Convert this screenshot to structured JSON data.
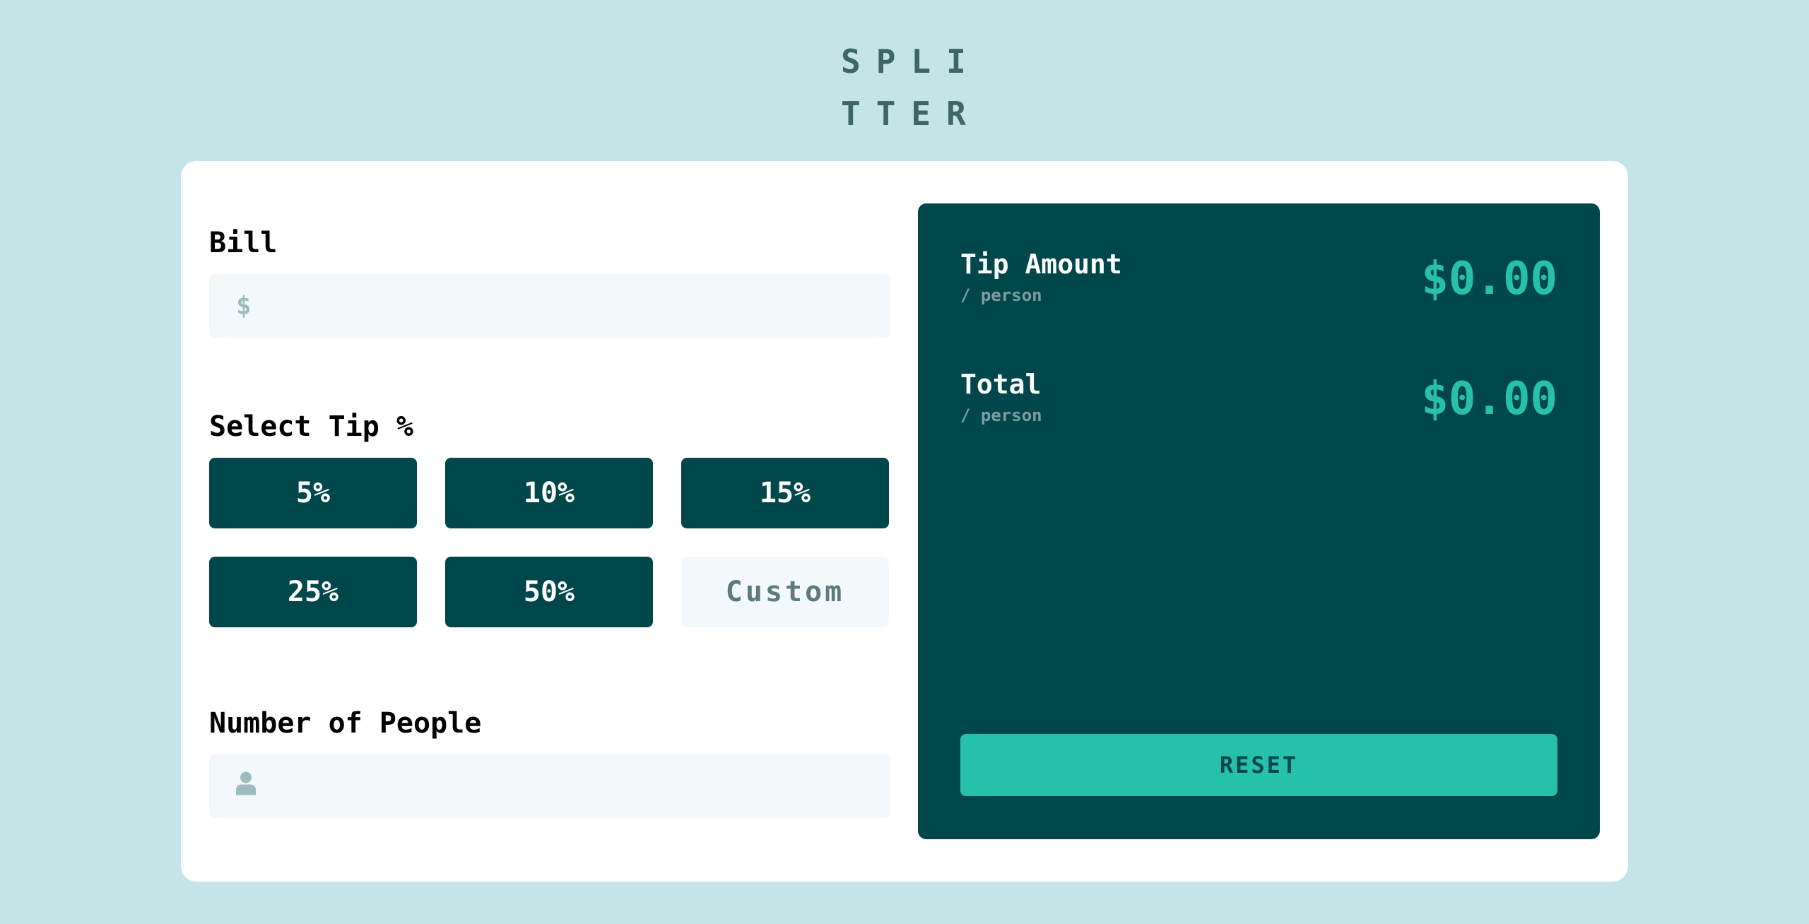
{
  "app": {
    "logo_line1": "SPLI",
    "logo_line2": "TTER"
  },
  "bill": {
    "label": "Bill",
    "icon": "dollar-icon",
    "icon_glyph": "$",
    "value": ""
  },
  "tip": {
    "label": "Select Tip %",
    "options": [
      "5%",
      "10%",
      "15%",
      "25%",
      "50%"
    ],
    "custom_placeholder": "Custom"
  },
  "people": {
    "label": "Number of People",
    "icon": "person-icon",
    "value": ""
  },
  "results": {
    "tip_amount_label": "Tip Amount",
    "tip_amount_sub": "/ person",
    "tip_amount_value": "$0.00",
    "total_label": "Total",
    "total_sub": "/ person",
    "total_value": "$0.00",
    "reset_label": "RESET"
  },
  "colors": {
    "background": "#c5e4e7",
    "dark_cyan": "#00474b",
    "strong_cyan": "#26c0ab",
    "input_bg": "#f3f9fa",
    "muted": "#9ebbbd"
  }
}
